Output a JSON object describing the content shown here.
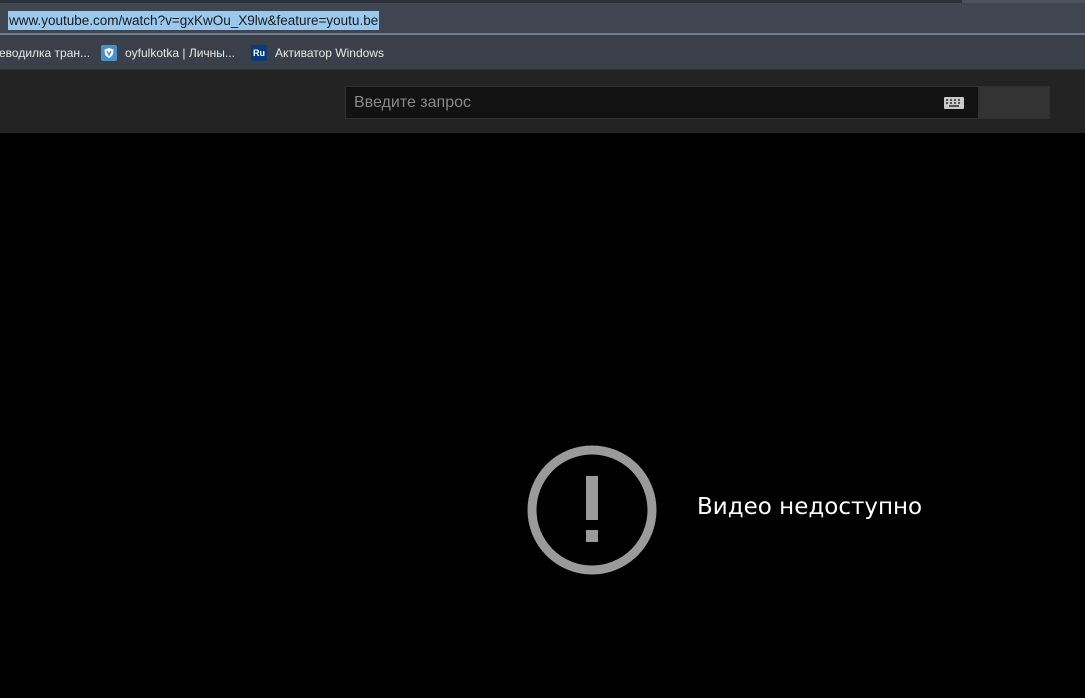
{
  "browser": {
    "url": "www.youtube.com/watch?v=gxKwOu_X9lw&feature=youtu.be",
    "bookmarks": [
      {
        "label": "еводилка тран...",
        "icon": "none"
      },
      {
        "label": "oyfulkotka | Личны...",
        "icon": "shield-icon"
      },
      {
        "label": "Активатор Windows",
        "icon": "ru-icon",
        "icon_text": "Ru"
      }
    ]
  },
  "masthead": {
    "search_placeholder": "Введите запрос"
  },
  "player": {
    "message": "Видео недоступно",
    "icon": "alert-circle-icon",
    "icon_color": "#9a9a9a"
  },
  "colors": {
    "url_highlight": "#99c9ef",
    "masthead_bg": "#232323",
    "player_bg": "#000000"
  }
}
